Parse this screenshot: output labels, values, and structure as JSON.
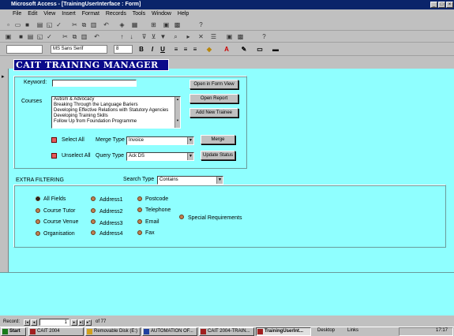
{
  "window": {
    "title": "Microsoft Access - [TrainingUserInterface : Form]"
  },
  "menu": [
    "File",
    "Edit",
    "View",
    "Insert",
    "Format",
    "Records",
    "Tools",
    "Window",
    "Help"
  ],
  "format_toolbar": {
    "font_name": "MS Sans Serif",
    "font_size": "8",
    "bold": "B",
    "italic": "I",
    "underline": "U"
  },
  "form": {
    "header_title": "CAIT TRAINING MANAGER",
    "keyword_label": "Keyword:",
    "keyword_value": "",
    "courses_label": "Courses",
    "courses": [
      "Autism & Advocacy",
      "Breaking Through the Language Bariers",
      "Developing Effective Relations with Statutory Agencies",
      "Developing Training Skills",
      "Follow Up from Foundation Programme"
    ],
    "buttons": {
      "open_form_view": "Open in Form View",
      "open_report": "Open Report",
      "add_trainee": "Add New Trainee",
      "merge": "Merge",
      "update_status": "Update Status"
    },
    "select_all": "Select All",
    "unselect_all": "Unselect All",
    "merge_type_label": "Merge Type",
    "merge_type_value": "Invoice",
    "query_type_label": "Query Type",
    "query_type_value": "Ack DS",
    "extra_filtering": "EXTRA FILTERING",
    "search_type_label": "Search Type",
    "search_type_value": "Contains",
    "filters": {
      "col1": [
        "All Fields",
        "Course Tutor",
        "Course Venue",
        "Organisation"
      ],
      "col2": [
        "Address1",
        "Address2",
        "Address3",
        "Address4"
      ],
      "col3": [
        "Postcode",
        "Telephone",
        "Email",
        "Fax"
      ],
      "col4": [
        "Special Requirements"
      ]
    },
    "selected_filter": "All Fields"
  },
  "record_nav": {
    "label": "Record:",
    "current": "1",
    "of_text": "of 77"
  },
  "taskbar": {
    "start": "Start",
    "tasks": [
      "CAIT 2004",
      "Removable Disk (E:)",
      "AUTOMATION OF...",
      "CAIT 2004-TRAIN...",
      "TrainingUserInt..."
    ],
    "desktop": "Desktop",
    "links": "Links",
    "clock": "17:17"
  },
  "colors": {
    "form_bg": "#8fffff",
    "header_bg": "#0a0a8a",
    "titlebar": "#0a246a"
  }
}
